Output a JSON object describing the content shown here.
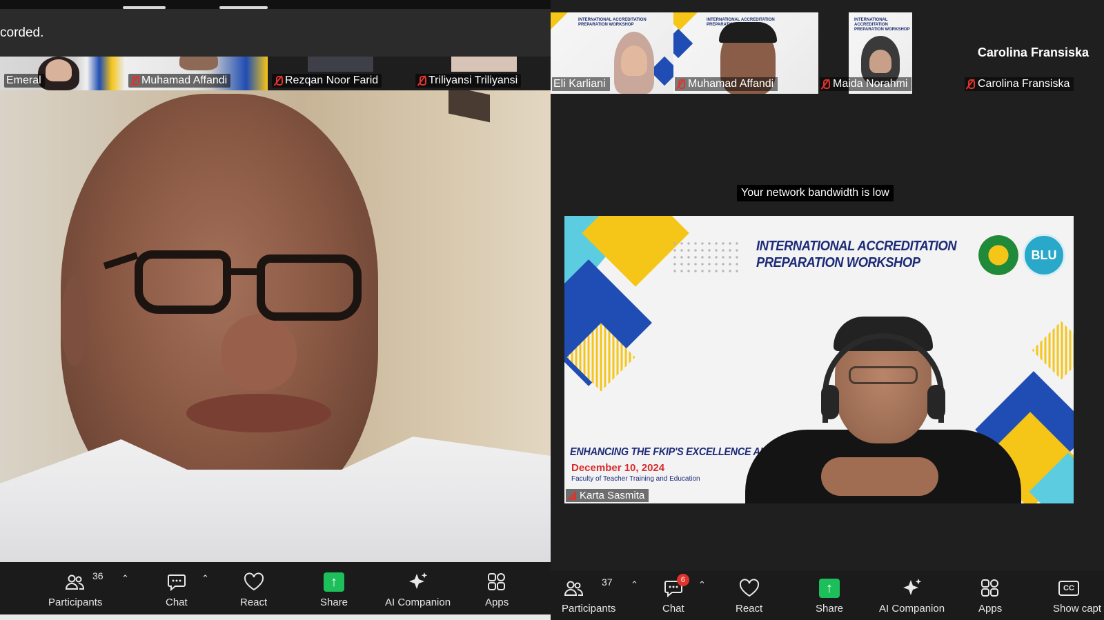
{
  "left": {
    "banner_text": "corded.",
    "thumbnails": [
      {
        "name": "Emeral"
      },
      {
        "name": "Muhamad Affandi"
      },
      {
        "name": "Rezqan Noor Farid"
      },
      {
        "name": "Triliyansi Triliyansi"
      }
    ],
    "toolbar": {
      "participants_label": "Participants",
      "participants_count": "36",
      "chat_label": "Chat",
      "react_label": "React",
      "share_label": "Share",
      "ai_label": "AI Companion",
      "apps_label": "Apps"
    }
  },
  "right": {
    "thumbnails": [
      {
        "name": "Eli Karliani"
      },
      {
        "name": "Muhamad Affandi"
      },
      {
        "name": "Maida Norahmi"
      },
      {
        "name": "Carolina Fransiska"
      }
    ],
    "carolina_header": "Carolina Fransiska",
    "notice": "Your network bandwidth is low",
    "slide": {
      "title_line1": "INTERNATIONAL ACCREDITATION",
      "title_line2": "PREPARATION WORKSHOP",
      "logo_text": "BLU",
      "subtitle": "ENHANCING THE FKIP'S EXCELLENCE AI",
      "date": "December 10, 2024",
      "faculty": "Faculty of Teacher Training and Education"
    },
    "speaker_name": "Karta Sasmita",
    "toolbar": {
      "participants_label": "Participants",
      "participants_count": "37",
      "chat_label": "Chat",
      "chat_badge": "6",
      "react_label": "React",
      "share_label": "Share",
      "ai_label": "AI Companion",
      "apps_label": "Apps",
      "captions_label": "Show capt",
      "captions_icon_text": "CC"
    }
  },
  "colors": {
    "share_green": "#1dbf5b",
    "mute_red": "#e0332c",
    "toolbar_bg": "#1b1b1b",
    "slide_navy": "#1c2b78",
    "slide_yellow": "#f5c518",
    "slide_blue": "#1f4db3"
  }
}
